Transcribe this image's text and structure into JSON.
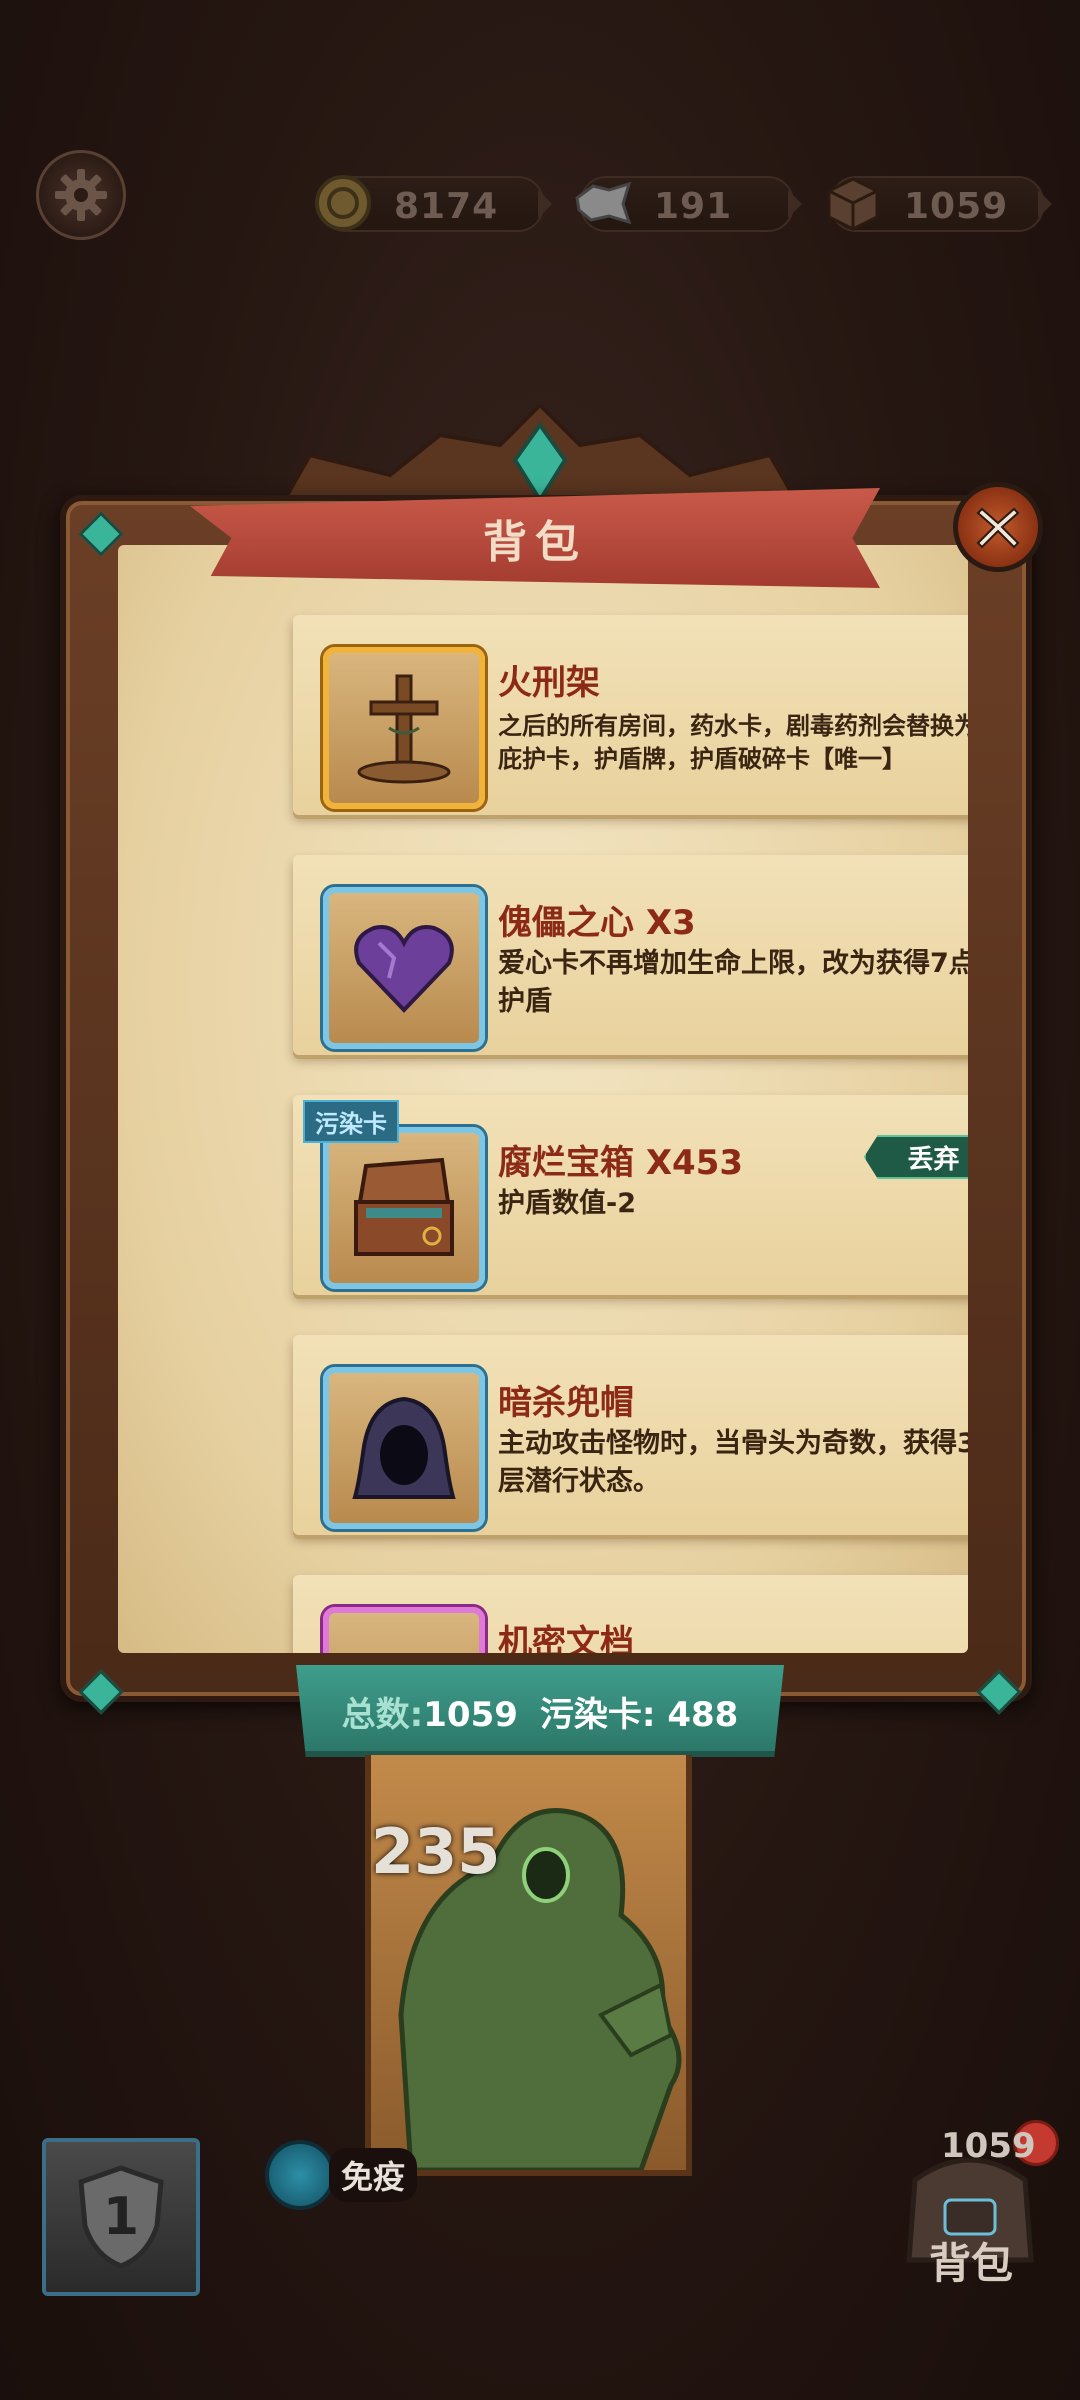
{
  "top_bar": {
    "settings_icon": "gear-icon",
    "resources": [
      {
        "icon": "coin-icon",
        "value": "8174"
      },
      {
        "icon": "bone-icon",
        "value": "191"
      },
      {
        "icon": "crate-icon",
        "value": "1059"
      }
    ]
  },
  "panel": {
    "title": "背包",
    "close_icon": "close-icon",
    "items": [
      {
        "name": "火刑架",
        "description": "之后的所有房间，药水卡，剧毒药剂会替换为庇护卡，护盾牌，护盾破碎卡【唯一】",
        "icon": "stake-icon",
        "frame": "gold"
      },
      {
        "name": "傀儡之心 X3",
        "description": "爱心卡不再增加生命上限，改为获得7点护盾",
        "icon": "heart-icon",
        "frame": "blue"
      },
      {
        "name": "腐烂宝箱 X453",
        "description": "护盾数值-2",
        "icon": "chest-icon",
        "frame": "blue",
        "tag": "污染卡",
        "discard_label": "丢弃"
      },
      {
        "name": "暗杀兜帽",
        "description": "主动攻击怪物时，当骨头为奇数，获得3层潜行状态。",
        "icon": "hood-icon",
        "frame": "blue"
      },
      {
        "name": "机密文档",
        "description": "",
        "icon": "document-icon",
        "frame": "pink"
      }
    ],
    "totals": {
      "total_label": "总数:",
      "total_value": "1059",
      "polluted_label": "污染卡:",
      "polluted_value": "488"
    }
  },
  "monster": {
    "value": "235"
  },
  "bottom_bar": {
    "shield_level": "1",
    "immune_label": "免疫",
    "bag_count": "1059",
    "bag_label": "背包"
  }
}
